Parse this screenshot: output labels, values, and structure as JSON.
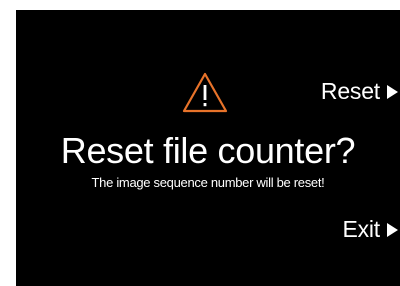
{
  "dialog": {
    "title": "Reset file counter?",
    "message": "The image sequence number will be reset!"
  },
  "softkeys": {
    "reset_label": "Reset",
    "exit_label": "Exit"
  },
  "icons": {
    "warning": "warning-triangle-icon",
    "arrow": "play-arrow-icon"
  },
  "colors": {
    "background": "#000000",
    "text": "#ffffff",
    "warning_accent": "#e8732a"
  }
}
